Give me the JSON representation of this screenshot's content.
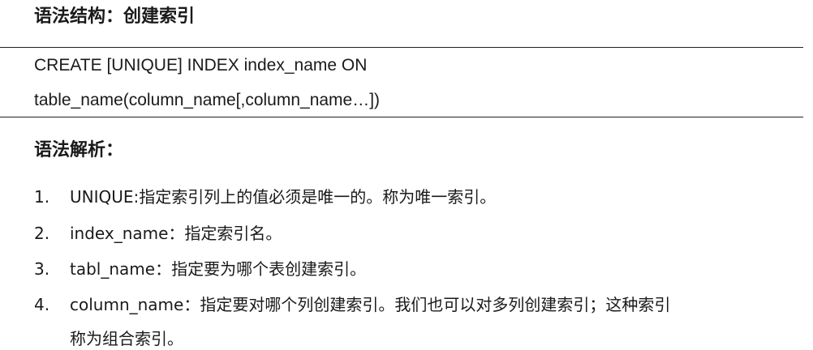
{
  "syntax_heading": "语法结构：创建索引",
  "code": {
    "line1": "CREATE [UNIQUE] INDEX index_name ON",
    "line2": "table_name(column_name[,column_name…])"
  },
  "analysis_heading": "语法解析：",
  "items": [
    {
      "num": "1.",
      "text": "UNIQUE:指定索引列上的值必须是唯一的。称为唯一索引。"
    },
    {
      "num": "2.",
      "text": "index_name：指定索引名。"
    },
    {
      "num": "3.",
      "text": "tabl_name：指定要为哪个表创建索引。"
    },
    {
      "num": "4.",
      "text": "column_name：指定要对哪个列创建索引。我们也可以对多列创建索引；这种索引",
      "continuation": "称为组合索引。"
    }
  ]
}
